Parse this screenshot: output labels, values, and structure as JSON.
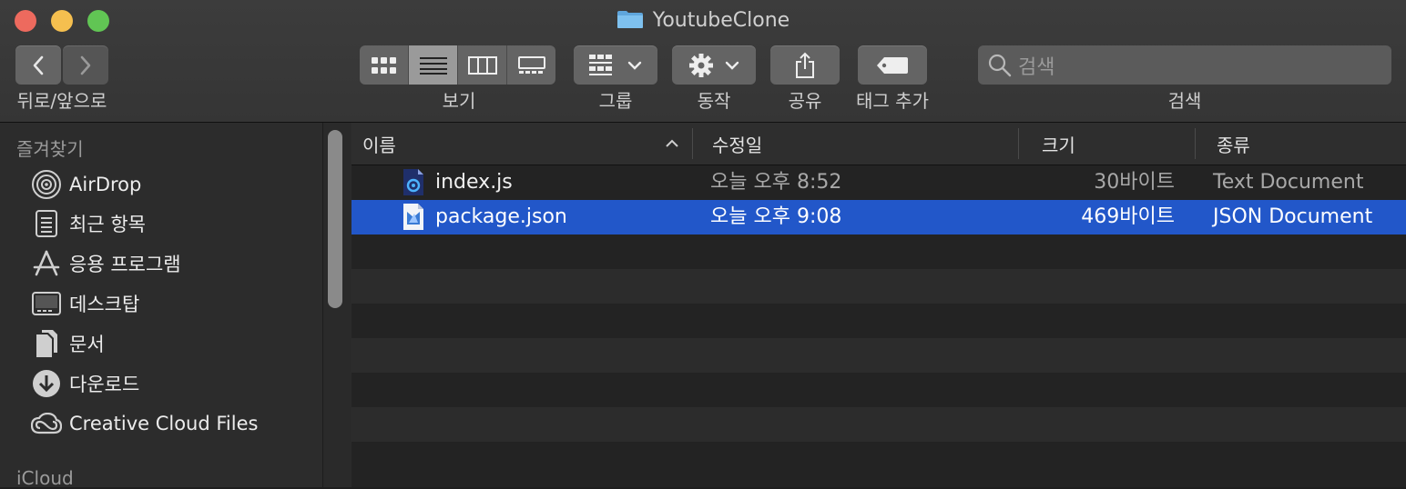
{
  "window": {
    "title": "YoutubeClone"
  },
  "toolbar": {
    "nav_label": "뒤로/앞으로",
    "view_label": "보기",
    "group_label": "그룹",
    "action_label": "동작",
    "share_label": "공유",
    "tag_label": "태그 추가",
    "search_label": "검색",
    "search_placeholder": "검색"
  },
  "sidebar": {
    "favorites_label": "즐겨찾기",
    "items": [
      {
        "label": "AirDrop",
        "icon": "airdrop-icon"
      },
      {
        "label": "최근 항목",
        "icon": "recents-icon"
      },
      {
        "label": "응용 프로그램",
        "icon": "applications-icon"
      },
      {
        "label": "데스크탑",
        "icon": "desktop-icon"
      },
      {
        "label": "문서",
        "icon": "documents-icon"
      },
      {
        "label": "다운로드",
        "icon": "downloads-icon"
      },
      {
        "label": "Creative Cloud Files",
        "icon": "creative-cloud-icon"
      }
    ],
    "icloud_label": "iCloud"
  },
  "list": {
    "columns": {
      "name": "이름",
      "date": "수정일",
      "size": "크기",
      "kind": "종류"
    },
    "rows": [
      {
        "name": "index.js",
        "date": "오늘 오후 8:52",
        "size": "30바이트",
        "kind": "Text Document",
        "selected": false,
        "icon": "js-file-icon"
      },
      {
        "name": "package.json",
        "date": "오늘 오후 9:08",
        "size": "469바이트",
        "kind": "JSON Document",
        "selected": true,
        "icon": "json-file-icon"
      }
    ]
  },
  "colors": {
    "selection": "#2257c9",
    "close": "#ed6a5e",
    "minimize": "#f5bf4f",
    "maximize": "#61c554"
  }
}
